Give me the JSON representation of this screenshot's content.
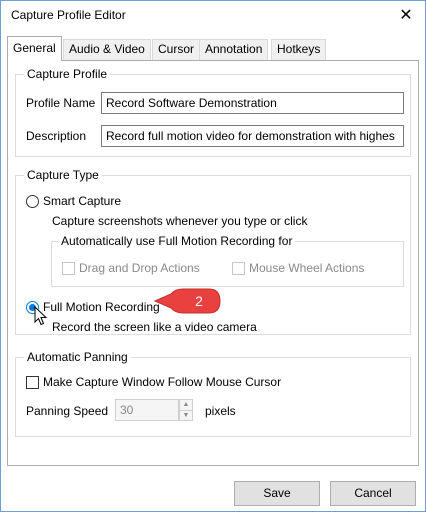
{
  "window": {
    "title": "Capture Profile Editor",
    "close_glyph": "✕"
  },
  "tabs": [
    {
      "label": "General",
      "active": true
    },
    {
      "label": "Audio & Video",
      "active": false
    },
    {
      "label": "Cursor",
      "active": false
    },
    {
      "label": "Annotation",
      "active": false
    },
    {
      "label": "Hotkeys",
      "active": false
    }
  ],
  "capture_profile": {
    "group_label": "Capture Profile",
    "profile_name_label": "Profile Name",
    "profile_name_value": "Record Software Demonstration",
    "description_label": "Description",
    "description_value": "Record full motion video for demonstration with highes"
  },
  "capture_type": {
    "group_label": "Capture Type",
    "smart_capture": {
      "label": "Smart Capture",
      "checked": false,
      "hint": "Capture screenshots whenever you type or click"
    },
    "auto_group_label": "Automatically use Full Motion Recording for",
    "drag_drop_label": "Drag and Drop Actions",
    "mouse_wheel_label": "Mouse Wheel Actions",
    "full_motion": {
      "label": "Full Motion Recording",
      "checked": true,
      "hint": "Record the screen like a video camera"
    },
    "callout_number": "2",
    "callout_color": "#e8413f"
  },
  "automatic_panning": {
    "group_label": "Automatic Panning",
    "follow_cursor_label": "Make Capture Window Follow Mouse Cursor",
    "follow_cursor_checked": false,
    "speed_label": "Panning Speed",
    "speed_value": "30",
    "speed_unit": "pixels"
  },
  "footer": {
    "save_label": "Save",
    "cancel_label": "Cancel"
  }
}
